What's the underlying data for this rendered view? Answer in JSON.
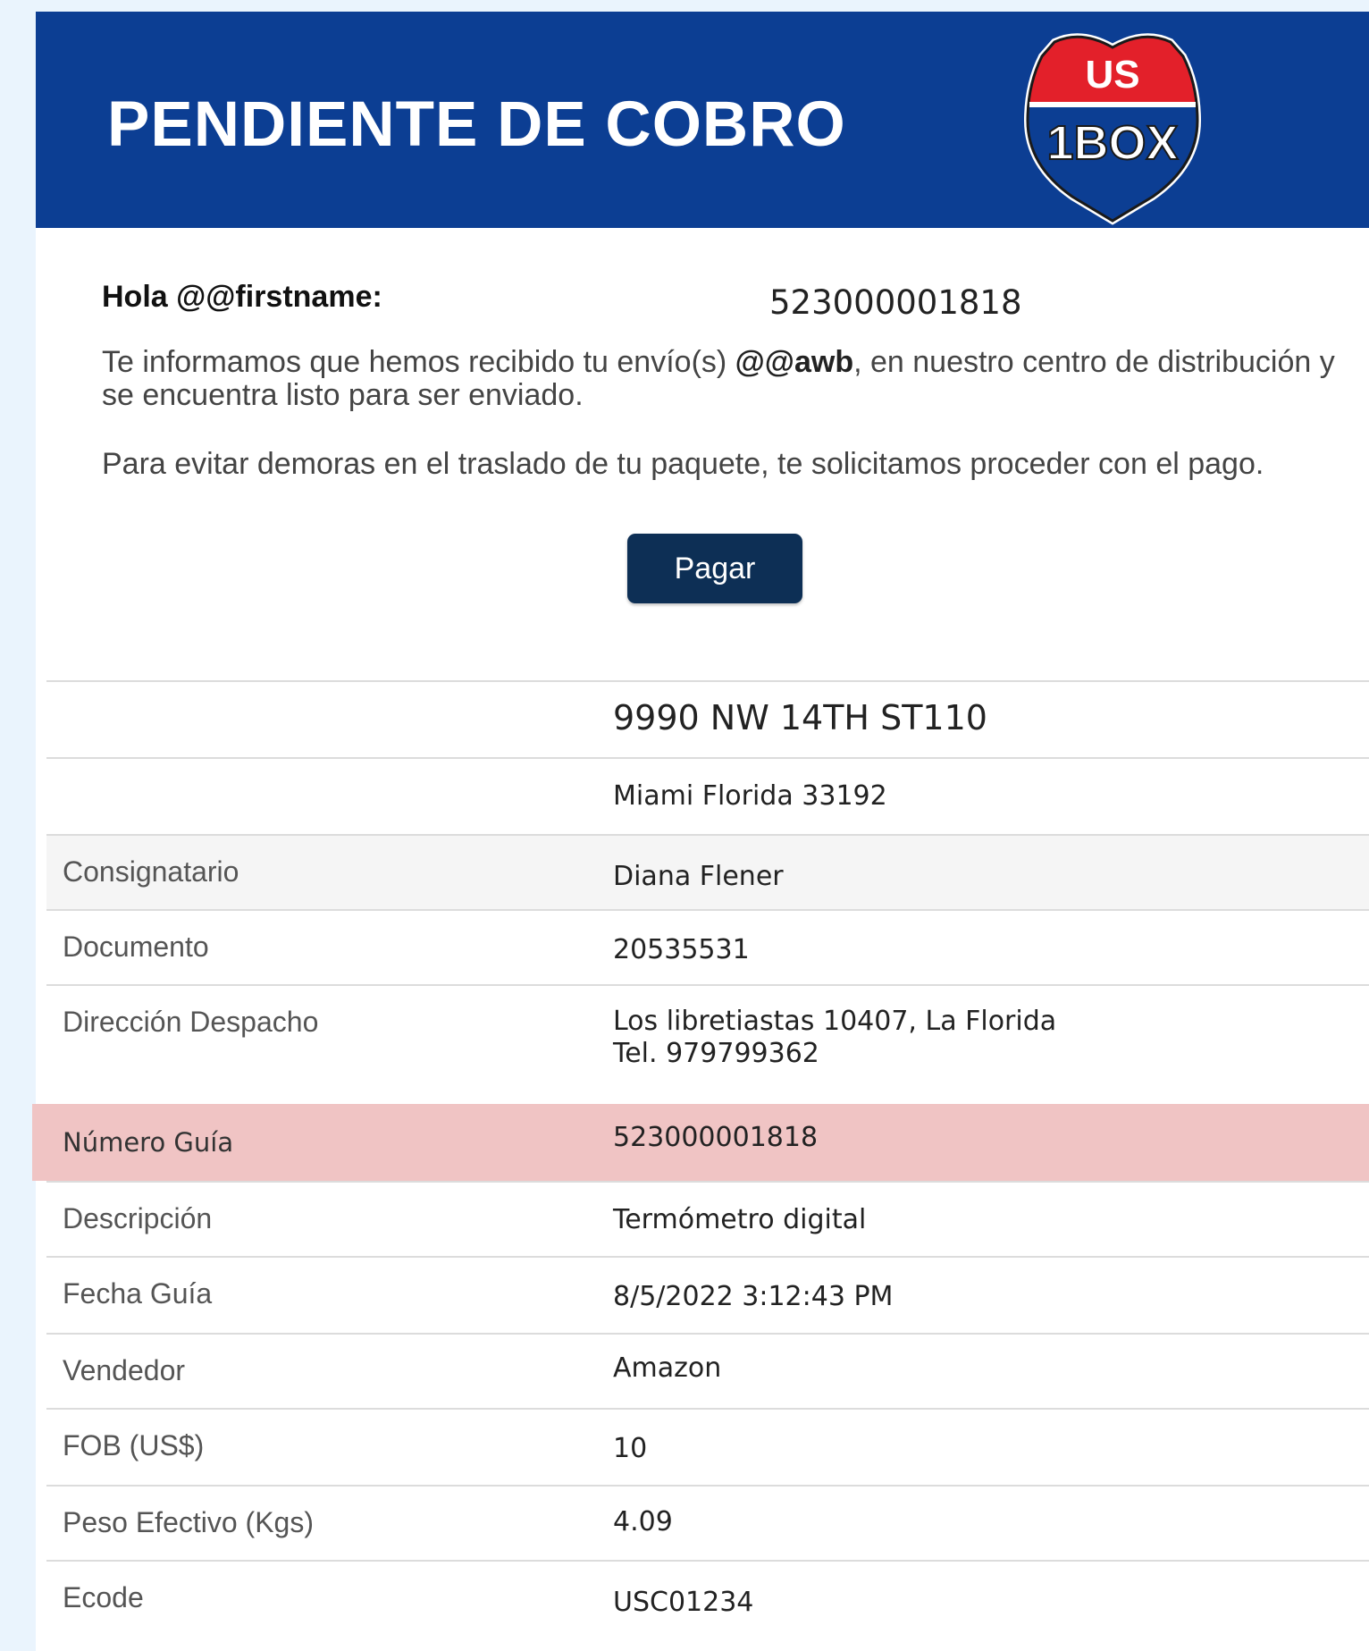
{
  "header": {
    "title": "PENDIENTE DE COBRO",
    "logo_top": "US",
    "logo_bottom": "1BOX"
  },
  "greeting": "Hola @@firstname:",
  "awb_number": "523000001818",
  "message": {
    "line1_start": "Te informamos que hemos recibido tu envío(s) ",
    "line1_bold": "@@awb",
    "line1_end": ", en nuestro centro de distribución y se encuentra listo para ser enviado.",
    "line2": "Para evitar demoras en el traslado de tu paquete, te solicitamos proceder con el pago."
  },
  "pay_button": "Pagar",
  "address": {
    "street": "9990 NW 14TH ST110",
    "city": "Miami Florida 33192"
  },
  "details": [
    {
      "label": "Consignatario",
      "value": "Diana Flener"
    },
    {
      "label": "Documento",
      "value": "20535531"
    },
    {
      "label": "Dirección Despacho",
      "value": "Los libretiastas 10407, La Florida",
      "value2": "Tel. 979799362"
    },
    {
      "label": "Número Guía",
      "value": "523000001818"
    },
    {
      "label": "Descripción",
      "value": "Termómetro digital"
    },
    {
      "label": "Fecha Guía",
      "value": "8/5/2022 3:12:43 PM"
    },
    {
      "label": "Vendedor",
      "value": "Amazon"
    },
    {
      "label": "FOB (US$)",
      "value": "10"
    },
    {
      "label": "Peso Efectivo (Kgs)",
      "value": "4.09"
    },
    {
      "label": "Ecode",
      "value": "USC01234"
    }
  ],
  "colors": {
    "header_bg": "#0c3e93",
    "button_bg": "#0d2f55",
    "highlight_row": "#f0c4c4",
    "logo_red": "#e3202a"
  }
}
